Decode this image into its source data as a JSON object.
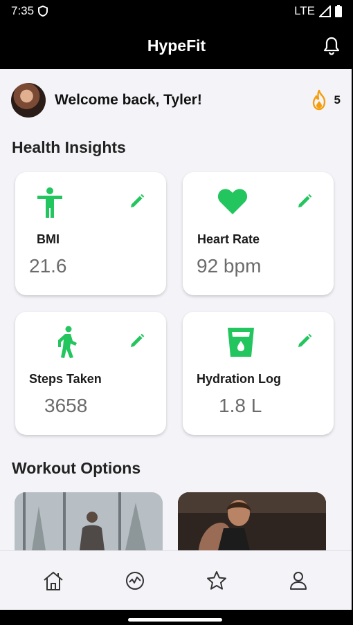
{
  "status_bar": {
    "time": "7:35",
    "network": "LTE"
  },
  "app_bar": {
    "title": "HypeFit"
  },
  "welcome": {
    "message": "Welcome back, Tyler!",
    "streak_count": "5"
  },
  "health_insights": {
    "title": "Health Insights",
    "cards": [
      {
        "label": "BMI",
        "value": "21.6",
        "icon": "person-icon"
      },
      {
        "label": "Heart Rate",
        "value": "92 bpm",
        "icon": "heart-icon"
      },
      {
        "label": "Steps Taken",
        "value": "3658",
        "icon": "walking-icon"
      },
      {
        "label": "Hydration Log",
        "value": "1.8 L",
        "icon": "water-glass-icon"
      }
    ]
  },
  "workout_options": {
    "title": "Workout Options"
  },
  "bottom_nav": {
    "items": [
      "home-icon",
      "activity-icon",
      "star-icon",
      "profile-icon"
    ]
  },
  "colors": {
    "accent_green": "#22c55e",
    "flame_orange": "#f59e0b",
    "background": "#f4f3f8"
  }
}
